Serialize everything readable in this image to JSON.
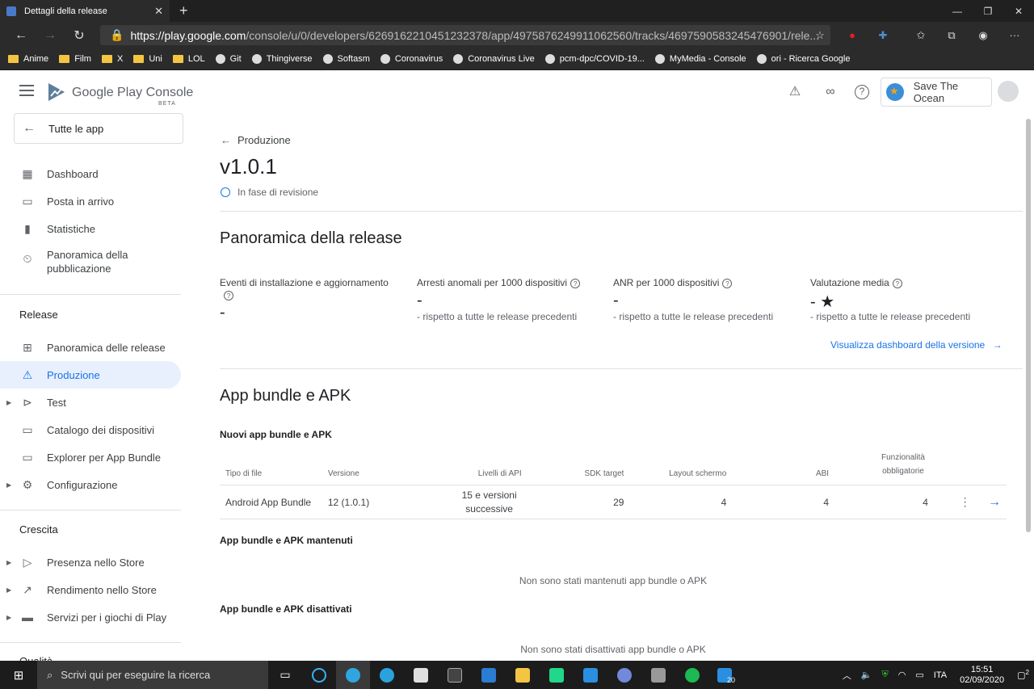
{
  "browser": {
    "tab_title": "Dettagli della release",
    "url_prefix": "https://",
    "url_host": "play.google.com",
    "url_path": "/console/u/0/developers/6269162210451232378/app/4975876249911062560/tracks/4697590583245476901/rele...",
    "bookmarks": [
      {
        "label": "Anime",
        "icon": "folder-icon"
      },
      {
        "label": "Film",
        "icon": "folder-icon"
      },
      {
        "label": "X",
        "icon": "folder-icon"
      },
      {
        "label": "Uni",
        "icon": "folder-icon"
      },
      {
        "label": "LOL",
        "icon": "folder-icon"
      },
      {
        "label": "Git",
        "icon": "github-icon"
      },
      {
        "label": "Thingiverse",
        "icon": "thingiverse-icon"
      },
      {
        "label": "Softasm",
        "icon": "softasm-icon"
      },
      {
        "label": "Coronavirus",
        "icon": "coronavirus-icon"
      },
      {
        "label": "Coronavirus Live",
        "icon": "coronavirus-live-icon"
      },
      {
        "label": "pcm-dpc/COVID-19...",
        "icon": "github-icon"
      },
      {
        "label": "MyMedia - Console",
        "icon": "mymedia-icon"
      },
      {
        "label": "ori - Ricerca Google",
        "icon": "google-icon"
      }
    ]
  },
  "header": {
    "brand": "Google Play Console",
    "badge": "BETA",
    "account": "Save The Ocean"
  },
  "sidebar": {
    "all_apps": "Tutte le app",
    "items_top": [
      "Dashboard",
      "Posta in arrivo",
      "Statistiche",
      "Panoramica della pubblicazione"
    ],
    "section_release": "Release",
    "items_release": [
      "Panoramica delle release",
      "Produzione",
      "Test",
      "Catalogo dei dispositivi",
      "Explorer per App Bundle",
      "Configurazione"
    ],
    "section_growth": "Crescita",
    "items_growth": [
      "Presenza nello Store",
      "Rendimento nello Store",
      "Servizi per i giochi di Play"
    ],
    "section_quality": "Qualità"
  },
  "main": {
    "back": "Produzione",
    "version": "v1.0.1",
    "status": "In fase di revisione",
    "overview_title": "Panoramica della release",
    "metrics": [
      {
        "label": "Eventi di installazione e aggiornamento",
        "value": "-",
        "sub": ""
      },
      {
        "label": "Arresti anomali per 1000 dispositivi",
        "value": "-",
        "sub": "- rispetto a tutte le release precedenti"
      },
      {
        "label": "ANR per 1000 dispositivi",
        "value": "-",
        "sub": "- rispetto a tutte le release precedenti"
      },
      {
        "label": "Valutazione media",
        "value": "- ★",
        "sub": "- rispetto a tutte le release precedenti"
      }
    ],
    "dashboard_link": "Visualizza dashboard della versione",
    "bundles_title": "App bundle e APK",
    "new_bundles": "Nuovi app bundle e APK",
    "columns": [
      "Tipo di file",
      "Versione",
      "Livelli di API",
      "SDK target",
      "Layout schermo",
      "ABI",
      "Funzionalità obbligatorie"
    ],
    "row": [
      "Android App Bundle",
      "12 (1.0.1)",
      "15 e versioni successive",
      "29",
      "4",
      "4",
      "4"
    ],
    "kept_title": "App bundle e APK mantenuti",
    "kept_empty": "Non sono stati mantenuti app bundle o APK",
    "disabled_title": "App bundle e APK disattivati",
    "disabled_empty": "Non sono stati disattivati app bundle o APK"
  },
  "taskbar": {
    "search": "Scrivi qui per eseguire la ricerca",
    "lang": "ITA",
    "time": "15:51",
    "date": "02/09/2020",
    "notif": "2",
    "badge_count": "20"
  }
}
